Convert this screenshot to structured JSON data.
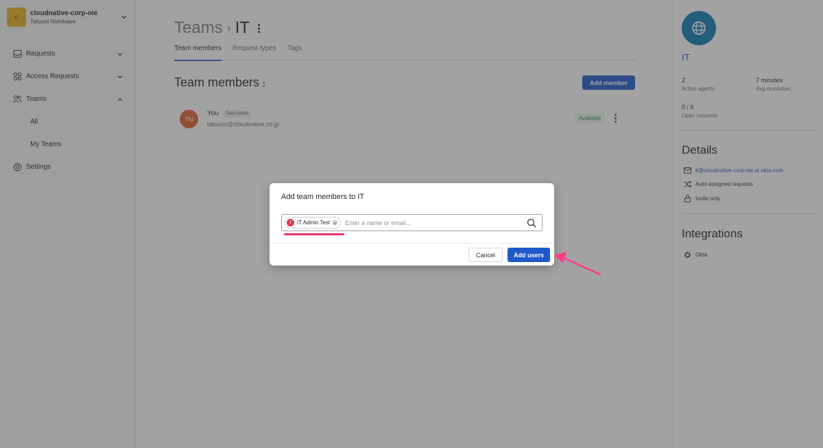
{
  "workspace": {
    "initial": "c",
    "name": "cloudnative-corp-oie",
    "user": "Tatsumi Nishikawa",
    "logo_color": "#e8b023"
  },
  "sidebar": {
    "items": [
      {
        "label": "Requests",
        "icon": "inbox-icon"
      },
      {
        "label": "Access Requests",
        "icon": "grid-icon"
      },
      {
        "label": "Teams",
        "icon": "people-icon"
      },
      {
        "label": "All"
      },
      {
        "label": "My Teams"
      },
      {
        "label": "Settings",
        "icon": "gear-icon"
      }
    ]
  },
  "header": {
    "breadcrumb_root": "Teams",
    "separator": "›",
    "team": "IT"
  },
  "tabs": [
    {
      "label": "Team members",
      "active": true
    },
    {
      "label": "Request types"
    },
    {
      "label": "Tags"
    }
  ],
  "members_section": {
    "title": "Team members",
    "count": "1",
    "add_button": "Add member"
  },
  "members": [
    {
      "initials": "TN",
      "name": "You",
      "role": "Team Admin",
      "email": "tatsumi@cloudnative.co.jp",
      "status": "Available",
      "avatar_color": "#e3612e"
    }
  ],
  "right_panel": {
    "team_name": "IT",
    "team_icon": "globe-icon",
    "stats": [
      {
        "value": "2",
        "caption": "Active agents"
      },
      {
        "value": "7 minutes",
        "caption": "Avg resolution"
      },
      {
        "value": "0 / 6",
        "caption": "Open requests"
      }
    ],
    "details_title": "Details",
    "details": [
      {
        "icon": "mail-icon",
        "text": "it@cloudnative-corp-oie.at.okta.com"
      },
      {
        "icon": "shuffle-icon",
        "text": "Auto-assigned requests"
      },
      {
        "icon": "lock-icon",
        "text": "Invite only"
      }
    ],
    "integrations_title": "Integrations",
    "integrations": [
      {
        "icon": "okta-icon",
        "text": "Okta"
      }
    ]
  },
  "modal": {
    "title": "Add team members to IT",
    "chip": {
      "label": "IT Admin Test",
      "icon": "!"
    },
    "input_placeholder": "Enter a name or email...",
    "cancel": "Cancel",
    "submit": "Add users"
  },
  "colors": {
    "primary": "#1f58c9",
    "accent": "#e8336c",
    "team_icon": "#0f7ab4"
  }
}
